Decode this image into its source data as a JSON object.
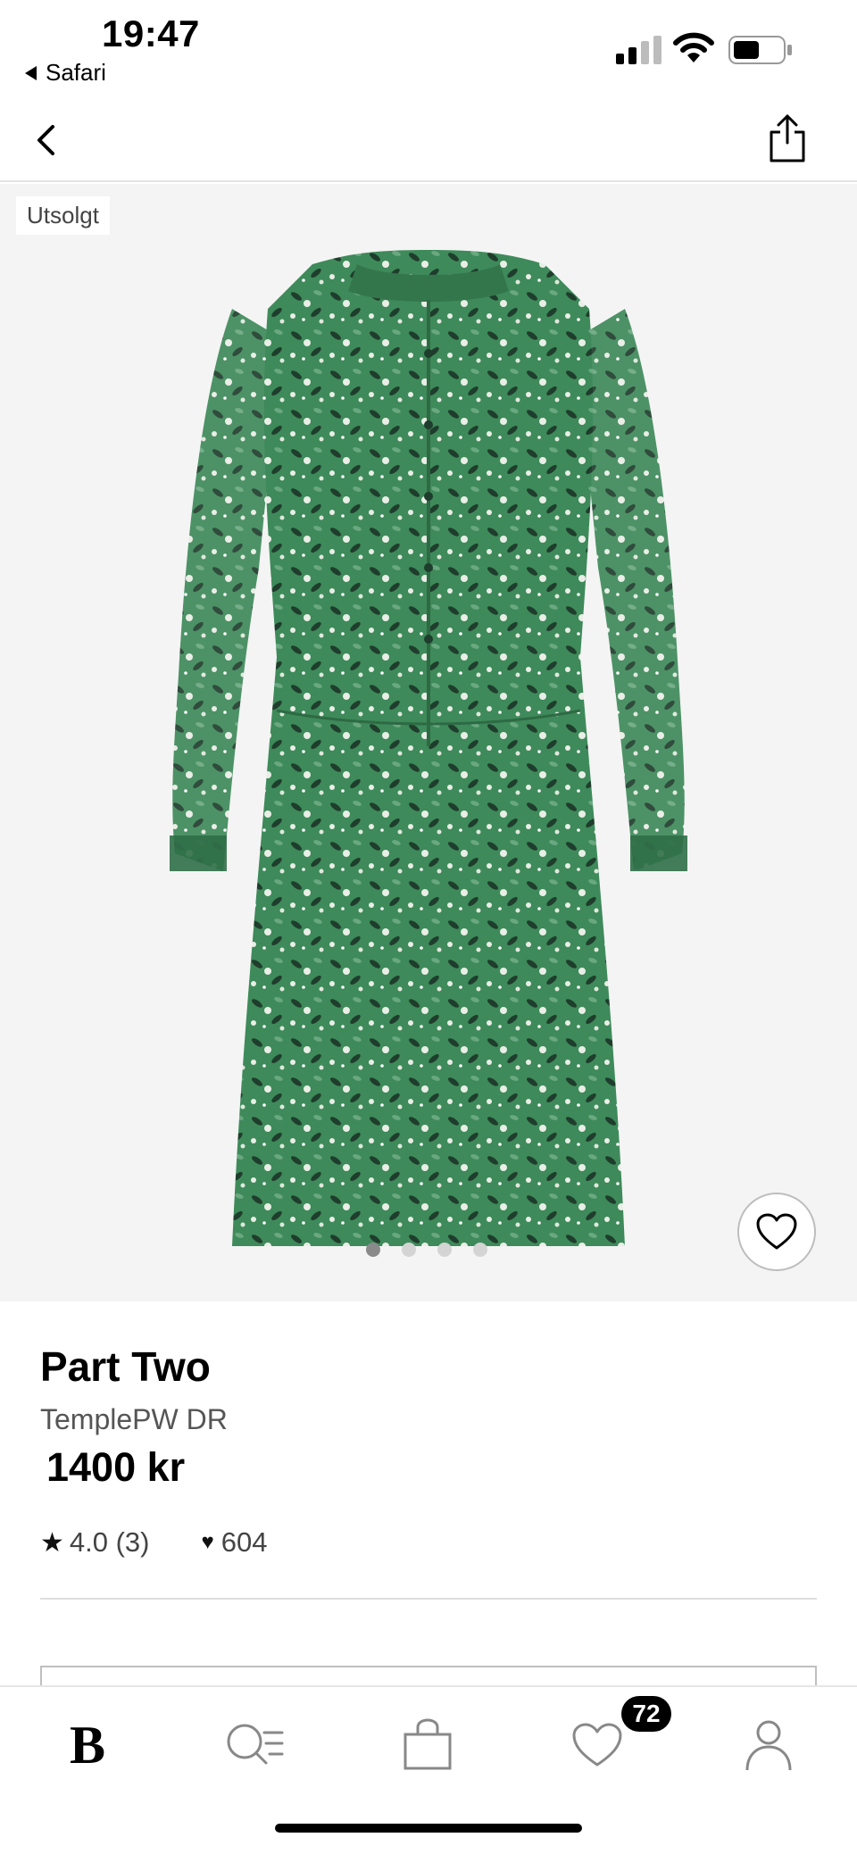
{
  "status_bar": {
    "time": "19:47",
    "back_app": "Safari"
  },
  "product": {
    "badge": "Utsolgt",
    "brand": "Part Two",
    "name": "TemplePW DR",
    "price": "1400 kr",
    "rating": "4.0 (3)",
    "favorites": "604",
    "image_count": 4,
    "active_image": 1,
    "dress_color": "#3e8a5a"
  },
  "tab_bar": {
    "logo": "B",
    "wishlist_badge": "72"
  },
  "icons": {
    "back": "chevron-left-icon",
    "share": "share-icon",
    "favorite": "heart-outline-icon",
    "search": "search-list-icon",
    "bag": "shopping-bag-icon",
    "wishlist": "heart-outline-icon",
    "profile": "user-icon"
  }
}
